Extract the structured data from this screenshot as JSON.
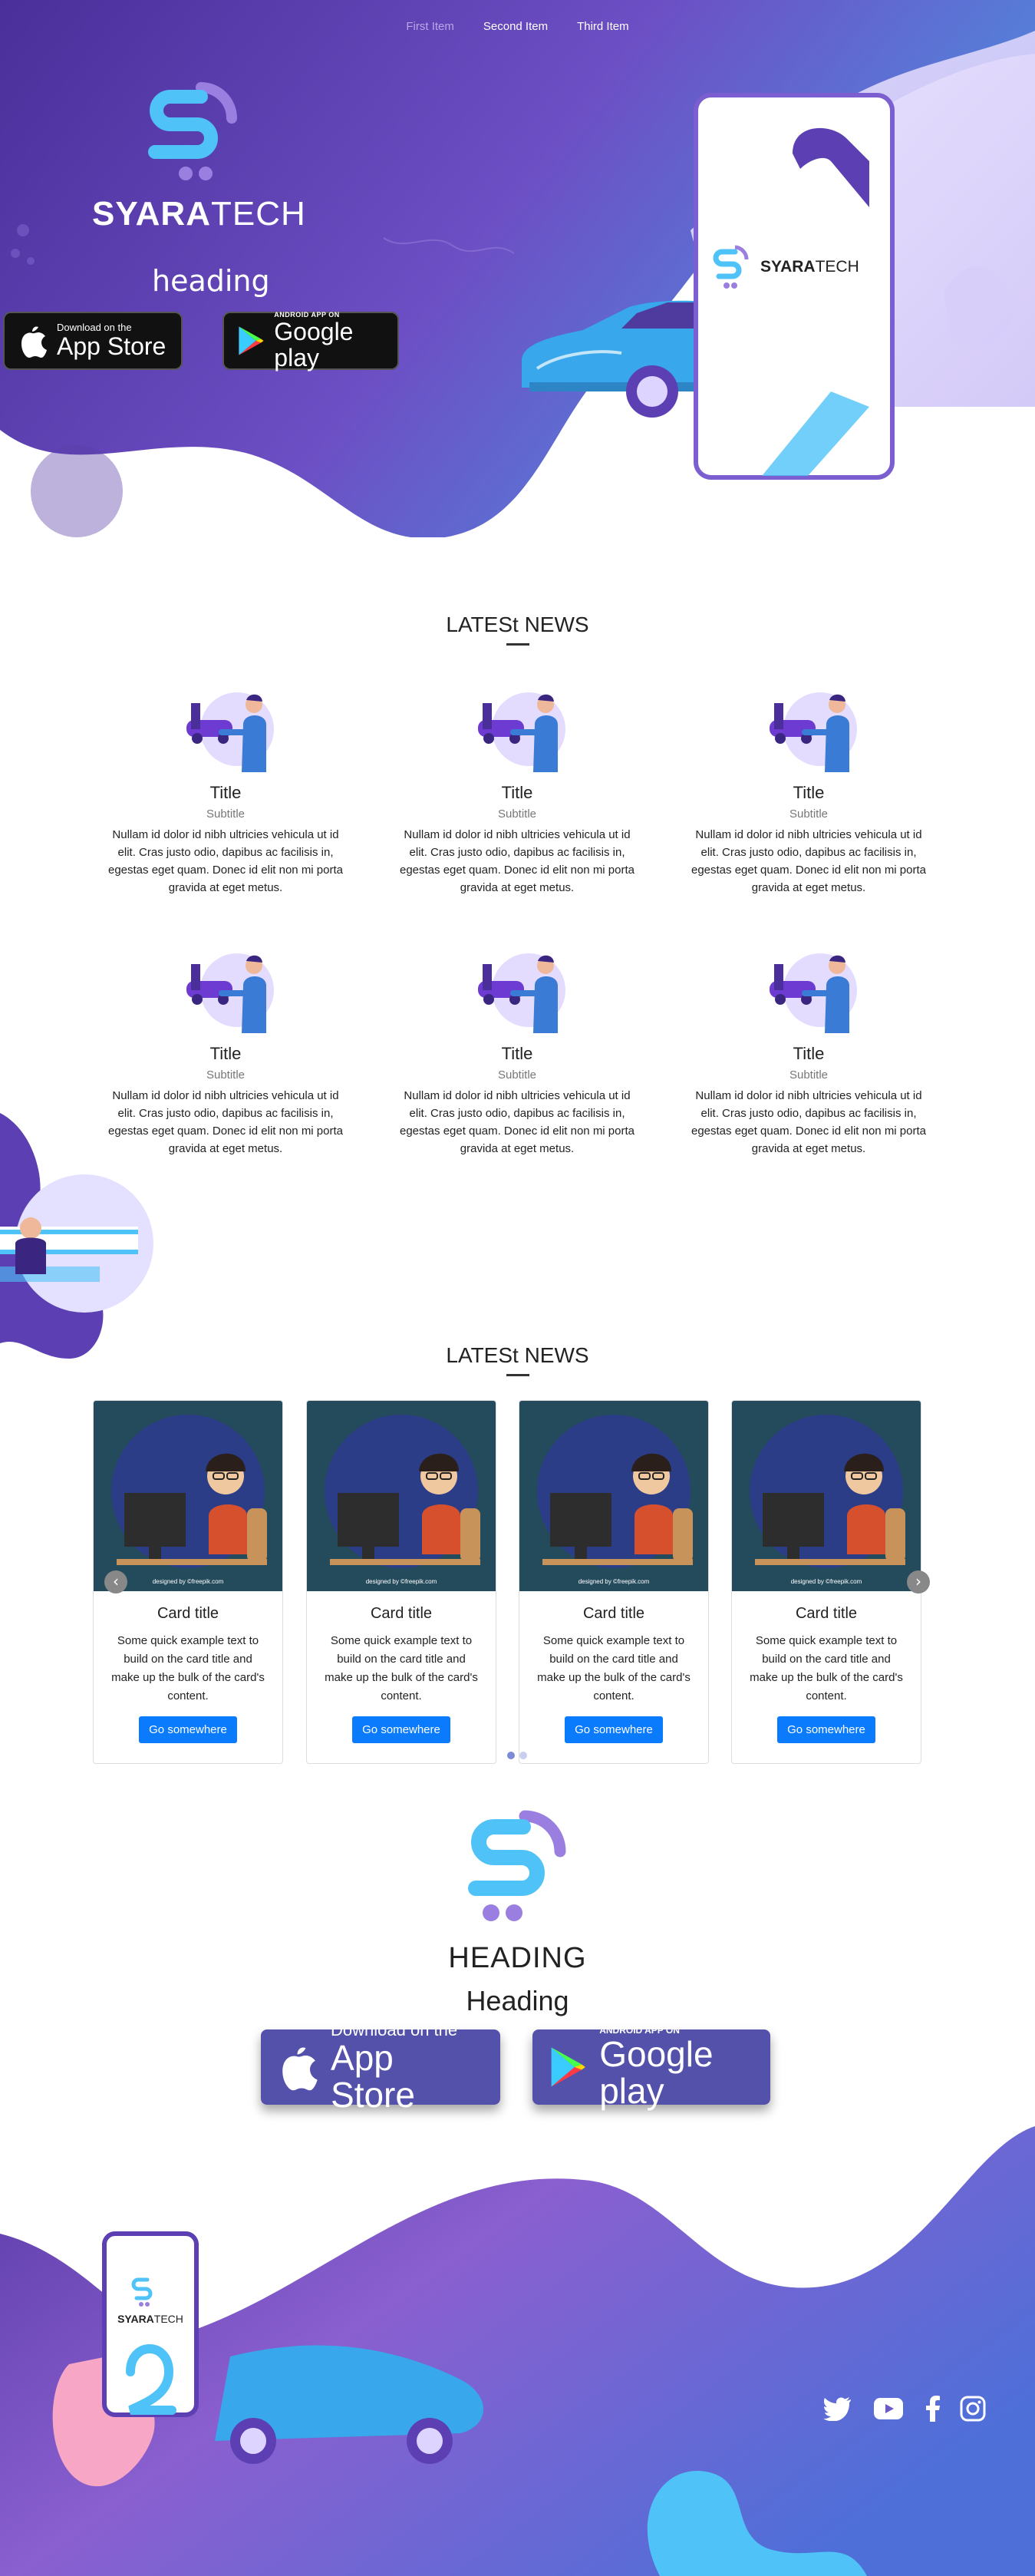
{
  "nav": {
    "items": [
      "First Item",
      "Second Item",
      "Third Item"
    ]
  },
  "hero": {
    "brand_bold": "SYARA",
    "brand_light": "TECH",
    "heading": "heading",
    "appstore_small": "Download on the",
    "appstore_large": "App Store",
    "googleplay_small": "ANDROID APP ON",
    "googleplay_large": "Google play",
    "phone_brand_bold": "SYARA",
    "phone_brand_light": "TECH"
  },
  "news": {
    "title": "LATESt NEWS",
    "items": [
      {
        "title": "Title",
        "subtitle": "Subtitle",
        "text": "Nullam id dolor id nibh ultricies vehicula ut id elit. Cras justo odio, dapibus ac facilisis in, egestas eget quam. Donec id elit non mi porta gravida at eget metus."
      },
      {
        "title": "Title",
        "subtitle": "Subtitle",
        "text": "Nullam id dolor id nibh ultricies vehicula ut id elit. Cras justo odio, dapibus ac facilisis in, egestas eget quam. Donec id elit non mi porta gravida at eget metus."
      },
      {
        "title": "Title",
        "subtitle": "Subtitle",
        "text": "Nullam id dolor id nibh ultricies vehicula ut id elit. Cras justo odio, dapibus ac facilisis in, egestas eget quam. Donec id elit non mi porta gravida at eget metus."
      },
      {
        "title": "Title",
        "subtitle": "Subtitle",
        "text": "Nullam id dolor id nibh ultricies vehicula ut id elit. Cras justo odio, dapibus ac facilisis in, egestas eget quam. Donec id elit non mi porta gravida at eget metus."
      },
      {
        "title": "Title",
        "subtitle": "Subtitle",
        "text": "Nullam id dolor id nibh ultricies vehicula ut id elit. Cras justo odio, dapibus ac facilisis in, egestas eget quam. Donec id elit non mi porta gravida at eget metus."
      },
      {
        "title": "Title",
        "subtitle": "Subtitle",
        "text": "Nullam id dolor id nibh ultricies vehicula ut id elit. Cras justo odio, dapibus ac facilisis in, egestas eget quam. Donec id elit non mi porta gravida at eget metus."
      }
    ]
  },
  "cards_section": {
    "title": "LATESt NEWS",
    "cards": [
      {
        "title": "Card title",
        "text": "Some quick example text to build on the card title and make up the bulk of the card's content.",
        "button": "Go somewhere",
        "credit": "designed by ©freepik.com"
      },
      {
        "title": "Card title",
        "text": "Some quick example text to build on the card title and make up the bulk of the card's content.",
        "button": "Go somewhere",
        "credit": "designed by ©freepik.com"
      },
      {
        "title": "Card title",
        "text": "Some quick example text to build on the card title and make up the bulk of the card's content.",
        "button": "Go somewhere",
        "credit": "designed by ©freepik.com"
      },
      {
        "title": "Card title",
        "text": "Some quick example text to build on the card title and make up the bulk of the card's content.",
        "button": "Go somewhere",
        "credit": "designed by ©freepik.com"
      }
    ],
    "prev_icon": "chevron-left-icon",
    "next_icon": "chevron-right-icon"
  },
  "bottom": {
    "heading1": "HEADING",
    "heading2": "Heading",
    "appstore_small": "Download on the",
    "appstore_large": "App Store",
    "googleplay_small": "ANDROID APP ON",
    "googleplay_large": "Google play",
    "phone_brand_bold": "SYARA",
    "phone_brand_light": "TECH"
  },
  "social": [
    "twitter-icon",
    "youtube-icon",
    "facebook-icon",
    "instagram-icon"
  ],
  "colors": {
    "primary_purple": "#5b3fb3",
    "accent_blue": "#4fc3f7",
    "button_blue": "#0a7bfd"
  }
}
